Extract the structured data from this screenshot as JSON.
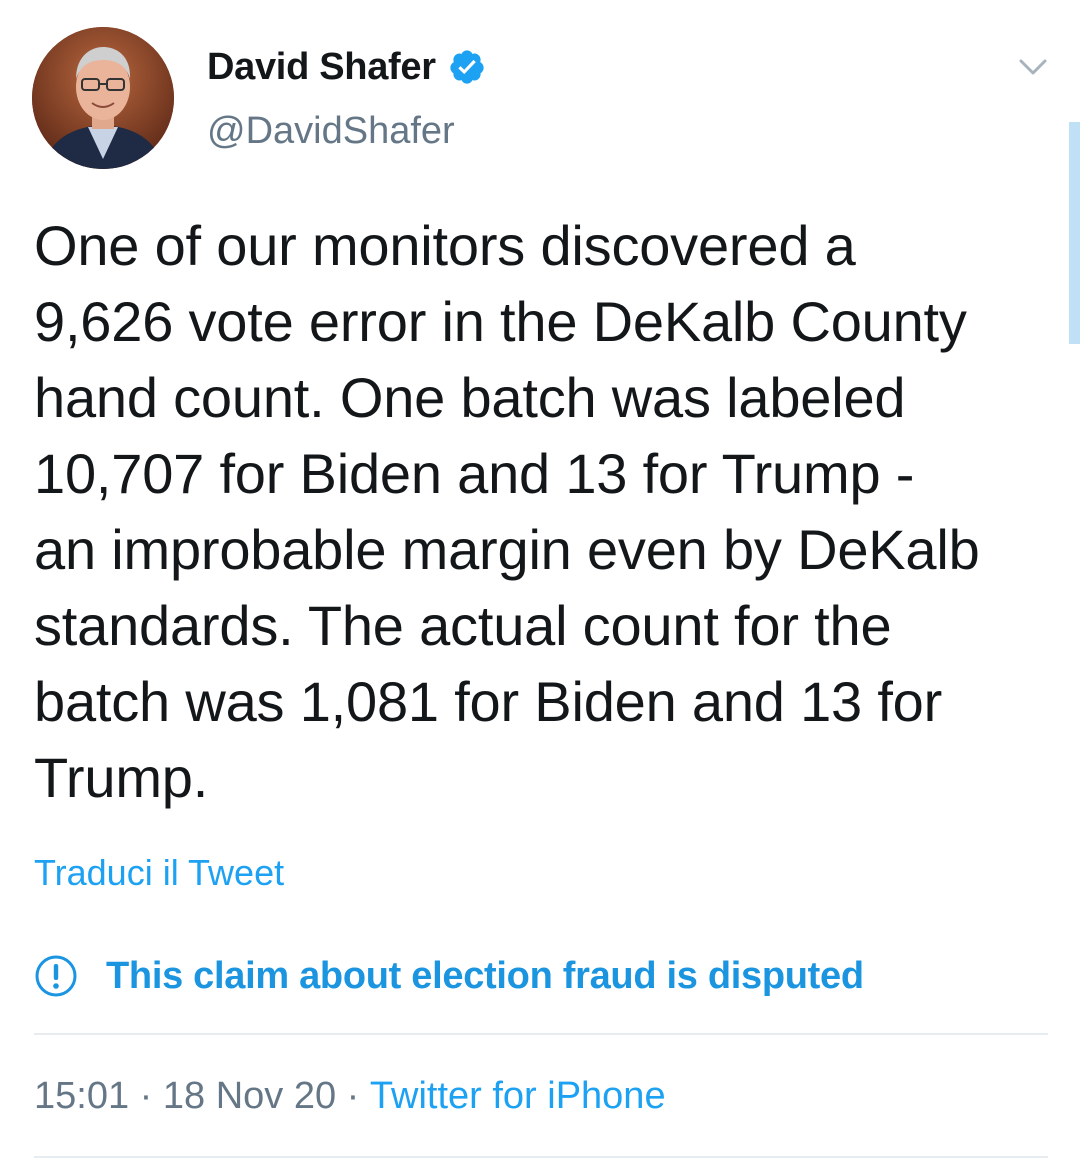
{
  "author": {
    "display_name": "David Shafer",
    "handle": "@DavidShafer",
    "verified": true,
    "avatar_icon": "profile-photo"
  },
  "tweet": {
    "text": "One of our monitors discovered a\n9,626 vote error in the DeKalb County\nhand count. One batch was labeled\n10,707 for Biden and 13 for Trump -\nan improbable margin even by DeKalb\nstandards. The actual count for the\nbatch was 1,081 for Biden and 13 for\nTrump.",
    "translate_label": "Traduci il Tweet"
  },
  "label": {
    "icon": "exclamation-circle-icon",
    "text": "This claim about election fraud is disputed"
  },
  "meta": {
    "time": "15:01",
    "separator_1": " · ",
    "date": "18 Nov 20",
    "separator_2": " · ",
    "source": "Twitter for iPhone"
  },
  "colors": {
    "accent": "#1da1f2",
    "label_blue": "#1b95e0",
    "secondary_text": "#657786",
    "primary_text": "#14171a",
    "divider": "#e6ecf0"
  }
}
